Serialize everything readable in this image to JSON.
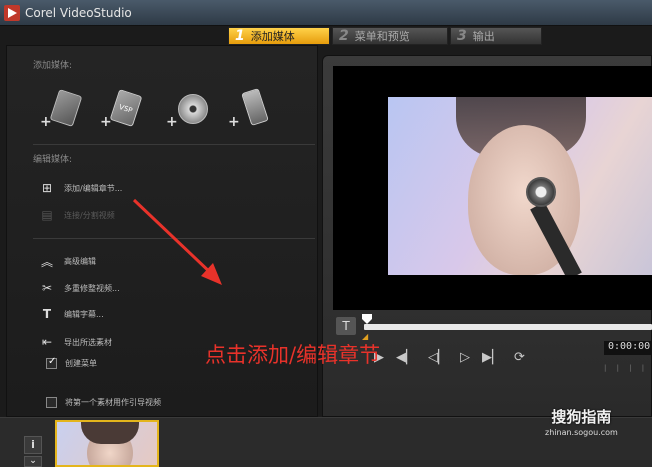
{
  "window": {
    "title": "Corel VideoStudio"
  },
  "tabs": [
    {
      "num": "1",
      "label": "添加媒体",
      "active": true
    },
    {
      "num": "2",
      "label": "菜单和预览",
      "active": false
    },
    {
      "num": "3",
      "label": "输出",
      "active": false
    }
  ],
  "left_panel": {
    "add_media_label": "添加媒体:",
    "media_buttons": [
      "add-video-icon",
      "add-vsp-project-icon",
      "add-disc-icon",
      "add-device-icon"
    ],
    "vsp_text": "VSP",
    "plus": "+",
    "edit_media_label": "编辑媒体:",
    "edit_ops": [
      {
        "label": "添加/编辑章节...",
        "enabled": true
      },
      {
        "label": "连接/分割视频",
        "enabled": false
      }
    ],
    "advanced": [
      {
        "label": "高级编辑"
      },
      {
        "label": "多重修整视频..."
      },
      {
        "label": "编辑字幕..."
      },
      {
        "label": "导出所选素材"
      },
      {
        "label": "创建菜单",
        "checked": true
      }
    ],
    "first_clip_checkbox": {
      "label": "将第一个素材用作引导视频",
      "checked": false
    }
  },
  "preview": {
    "timecode": "0:00:00",
    "ticks": "| | | |",
    "title_btn": "T"
  },
  "annotation": {
    "text": "点击添加/编辑章节",
    "color": "#e8322a"
  },
  "bottom": {
    "info_btn": "i",
    "expand_btn": "¥"
  },
  "watermark": {
    "logo": "搜狗指南",
    "url": "zhinan.sogou.com"
  }
}
